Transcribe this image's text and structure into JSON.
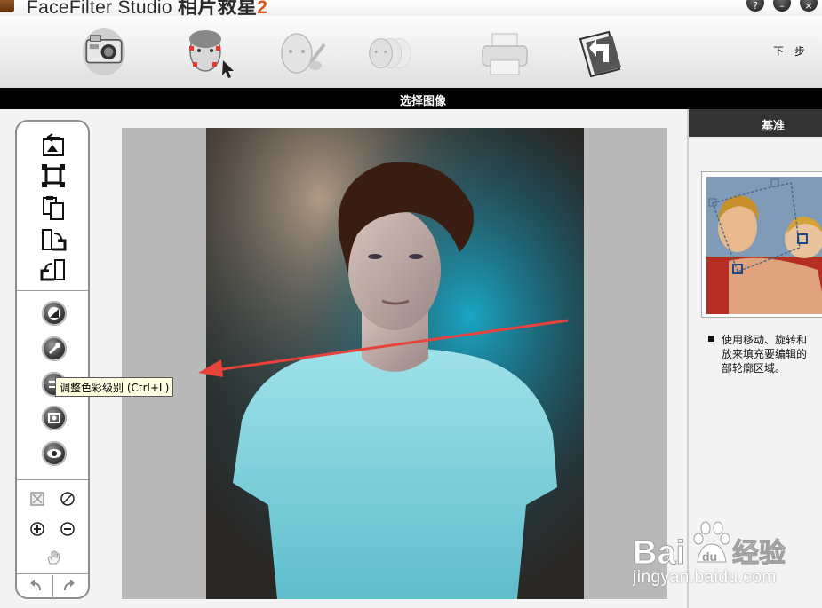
{
  "app": {
    "title_main": "FaceFilter Studio",
    "title_cn": "相片救星",
    "title_version": "2",
    "window_buttons": [
      "help-icon",
      "minimize-icon",
      "close-icon"
    ]
  },
  "toolbar": {
    "steps": [
      "camera-icon",
      "face-select-icon",
      "face-retouch-icon",
      "face-morph-icon",
      "printer-icon",
      "back-folder-icon"
    ],
    "next_label": "下一步"
  },
  "caption": "选择图像",
  "left_tools": {
    "file_tools": [
      "open-image-icon",
      "crop-icon",
      "paste-icon",
      "rotate-right-icon",
      "rotate-left-icon"
    ],
    "adjust_tools": [
      "contrast-icon",
      "auto-fix-icon",
      "color-levels-icon",
      "sharpen-icon",
      "red-eye-icon"
    ],
    "view_tools": [
      "fit-window-icon",
      "no-zoom-icon",
      "zoom-in-icon",
      "zoom-out-icon",
      "hand-pan-icon"
    ],
    "history_tools": [
      "undo-icon",
      "redo-icon"
    ]
  },
  "tooltip": "调整色彩级别 (Ctrl+L)",
  "right_panel": {
    "header": "基准",
    "instructions": [
      "使用移动、旋转和",
      "放来填充要编辑的",
      "部轮廓区域。"
    ]
  },
  "watermark": {
    "brand": "Bai",
    "brand_cn": "经验",
    "url": "jingyan.baidu.com"
  },
  "colors": {
    "caption_bg": "#000000",
    "right_header_bg": "#333333",
    "tooltip_bg": "#ffffe1",
    "arrow": "#e8423a",
    "version_accent": "#e0551b"
  }
}
